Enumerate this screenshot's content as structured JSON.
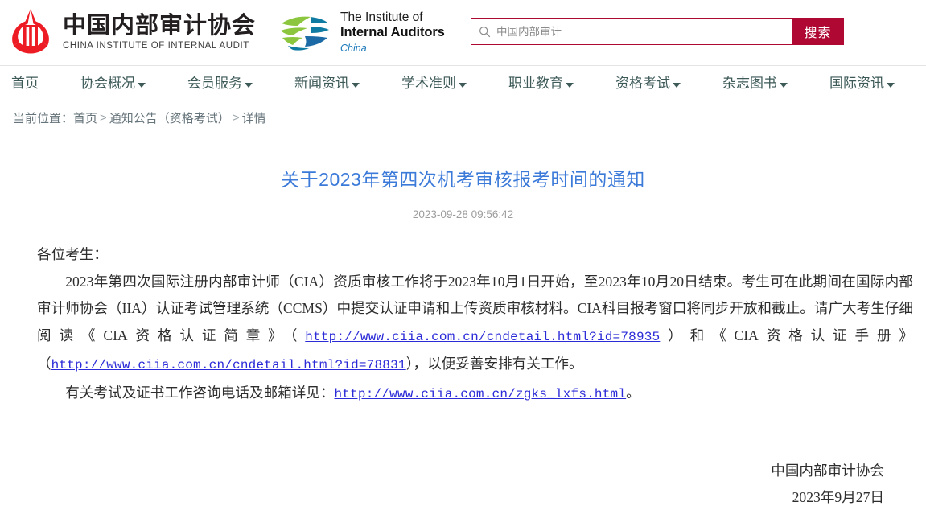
{
  "header": {
    "ciia_logo": {
      "icon": "ciia-emblem-icon",
      "cn_name": "中国内部审计协会",
      "en_name": "CHINA INSTITUTE OF INTERNAL AUDIT",
      "mark_color": "#ed1c24"
    },
    "iia_logo": {
      "icon": "iia-globe-icon",
      "line1": "The Institute of",
      "line2": "Internal Auditors",
      "line3": "China",
      "green": "#8cc63e",
      "blue_dark": "#0f7ba2",
      "blue_text": "#1878b9"
    },
    "search": {
      "icon": "search-icon",
      "placeholder": "中国内部审计",
      "value": "",
      "button_label": "搜索",
      "accent": "#af0933"
    }
  },
  "nav": {
    "items": [
      {
        "label": "首页",
        "has_caret": false
      },
      {
        "label": "协会概况",
        "has_caret": true
      },
      {
        "label": "会员服务",
        "has_caret": true
      },
      {
        "label": "新闻资讯",
        "has_caret": true
      },
      {
        "label": "学术准则",
        "has_caret": true
      },
      {
        "label": "职业教育",
        "has_caret": true
      },
      {
        "label": "资格考试",
        "has_caret": true
      },
      {
        "label": "杂志图书",
        "has_caret": true
      },
      {
        "label": "国际资讯",
        "has_caret": true
      }
    ],
    "text_color": "#3d5a58"
  },
  "breadcrumb": {
    "label": "当前位置：",
    "item1": "首页",
    "sep1": ">",
    "item2": "通知公告（资格考试）",
    "sep2": ">",
    "item3": "详情"
  },
  "article": {
    "title": "关于2023年第四次机考审核报考时间的通知",
    "title_color": "#3b7ad9",
    "time": "2023-09-28 09:56:42",
    "salutation": "各位考生：",
    "para1_a": "2023年第四次国际注册内部审计师（CIA）资质审核工作将于2023年10月1日开始，至2023年10月20日结束。考生可在此期间在国际内部审计师协会（IIA）认证考试管理系统（CCMS）中提交认证申请和上传资质审核材料。CIA科目报考窗口将同步开放和截止。请广大考生仔细阅读《CIA资格认证简章》（",
    "link1": "http://www.ciia.com.cn/cndetail.html?id=78935",
    "para1_b": "）和《CIA资格认证手册》（",
    "link2": "http://www.ciia.com.cn/cndetail.html?id=78831",
    "para1_c": "），以便妥善安排有关工作。",
    "para2_a": "有关考试及证书工作咨询电话及邮箱详见：",
    "link3": "http://www.ciia.com.cn/zgks_lxfs.html",
    "para2_b": "。",
    "sign_org": "中国内部审计协会",
    "sign_date": "2023年9月27日",
    "link_color": "#2b2bd8"
  }
}
